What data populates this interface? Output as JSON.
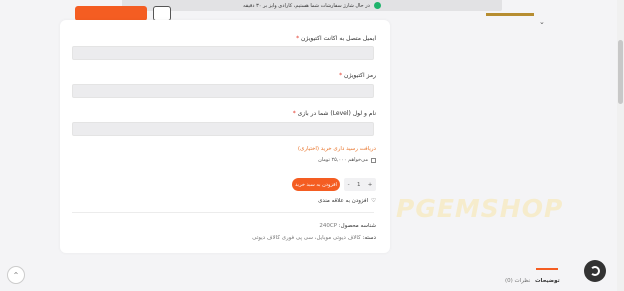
{
  "notice": {
    "text": "در حال شارژ سفارشات شما هستیم، کارادی وایز بر ۳۰ دقیقه"
  },
  "form": {
    "fields": [
      {
        "label": "ایمیل متصل به اکانت اکتیویژن",
        "required_mark": "*",
        "value": ""
      },
      {
        "label": "رمز اکتیویژن",
        "required_mark": "*",
        "value": ""
      },
      {
        "label": "نام و لول (Level) شما در بازی",
        "required_mark": "*",
        "value": ""
      }
    ],
    "upload_link": "دریافت رسید داری خرید (اختیاری)",
    "option_checkbox_label": "می‌خواهم ۲۵,۰۰۰ تومان",
    "quantity": {
      "value": "1",
      "plus": "+",
      "minus": "-"
    },
    "add_to_cart_label": "افزودن به سبد خرید",
    "compare_label": "افزودن به علاقه مندی",
    "sku_label": "شناسه محصول:",
    "sku_value": "240CP",
    "category_label": "دسته:",
    "category_value": "کالاف دیوتی موبایل، سی پی فوری کالاف دیوتی"
  },
  "watermark": {
    "text": "PGEMSHOP"
  },
  "tabs": {
    "description": "توضیحات",
    "reviews": "نظرات (0)"
  },
  "colors": {
    "accent": "#f45d22",
    "link": "#e8742b",
    "field_bg": "#ececee"
  },
  "icons": {
    "scroll_up": "chevron-up-icon",
    "chat": "chat-icon",
    "heart": "heart-icon",
    "chevron": "chevron-down-icon"
  }
}
